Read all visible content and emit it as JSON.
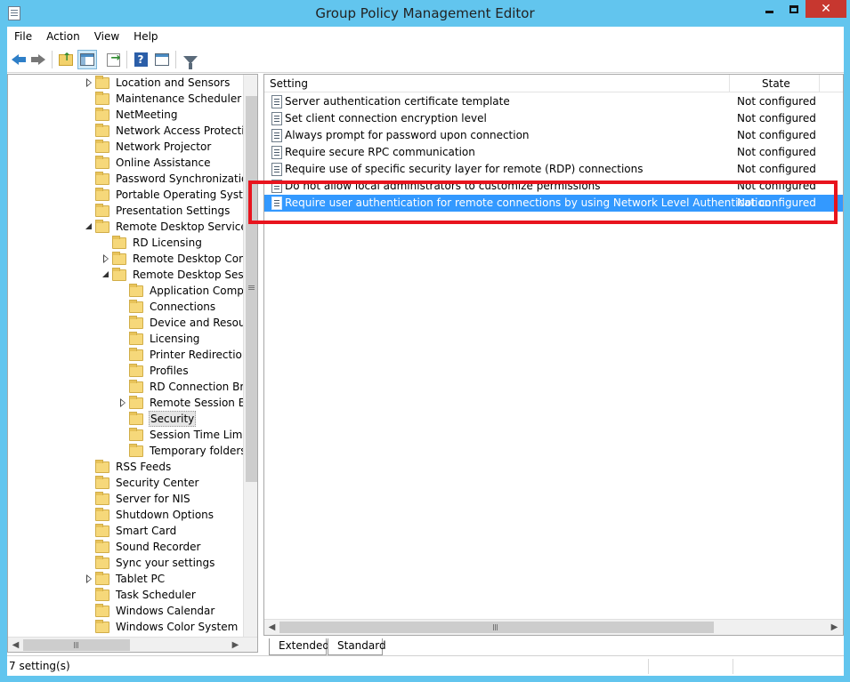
{
  "window": {
    "title": "Group Policy Management Editor",
    "min_symbol": "—",
    "max_symbol": "□",
    "close_symbol": "✕"
  },
  "menu": {
    "items": [
      "File",
      "Action",
      "View",
      "Help"
    ]
  },
  "toolbar": {
    "buttons": [
      "back-icon",
      "forward-icon",
      "up-folder-icon",
      "show-hide-tree-icon",
      "export-list-icon",
      "help-icon",
      "properties-icon",
      "filter-icon"
    ]
  },
  "tree": {
    "items": [
      {
        "label": "Location and Sensors",
        "expander": "collapsed"
      },
      {
        "label": "Maintenance Scheduler",
        "expander": ""
      },
      {
        "label": "NetMeeting",
        "expander": ""
      },
      {
        "label": "Network Access Protection",
        "expander": ""
      },
      {
        "label": "Network Projector",
        "expander": ""
      },
      {
        "label": "Online Assistance",
        "expander": ""
      },
      {
        "label": "Password Synchronization",
        "expander": ""
      },
      {
        "label": "Portable Operating System",
        "expander": ""
      },
      {
        "label": "Presentation Settings",
        "expander": ""
      },
      {
        "label": "Remote Desktop Services",
        "expander": "expanded"
      },
      {
        "label": "RD Licensing",
        "expander": ""
      },
      {
        "label": "Remote Desktop Conne",
        "expander": "collapsed"
      },
      {
        "label": "Remote Desktop Session",
        "expander": "expanded"
      },
      {
        "label": "Application Compat",
        "expander": ""
      },
      {
        "label": "Connections",
        "expander": ""
      },
      {
        "label": "Device and Resource",
        "expander": ""
      },
      {
        "label": "Licensing",
        "expander": ""
      },
      {
        "label": "Printer Redirection",
        "expander": ""
      },
      {
        "label": "Profiles",
        "expander": ""
      },
      {
        "label": "RD Connection Brok",
        "expander": ""
      },
      {
        "label": "Remote Session Envi",
        "expander": "collapsed"
      },
      {
        "label": "Security",
        "expander": "",
        "selected": true
      },
      {
        "label": "Session Time Limits",
        "expander": ""
      },
      {
        "label": "Temporary folders",
        "expander": ""
      },
      {
        "label": "RSS Feeds",
        "expander": ""
      },
      {
        "label": "Security Center",
        "expander": ""
      },
      {
        "label": "Server for NIS",
        "expander": ""
      },
      {
        "label": "Shutdown Options",
        "expander": ""
      },
      {
        "label": "Smart Card",
        "expander": ""
      },
      {
        "label": "Sound Recorder",
        "expander": ""
      },
      {
        "label": "Sync your settings",
        "expander": ""
      },
      {
        "label": "Tablet PC",
        "expander": "collapsed"
      },
      {
        "label": "Task Scheduler",
        "expander": ""
      },
      {
        "label": "Windows Calendar",
        "expander": ""
      },
      {
        "label": "Windows Color System",
        "expander": ""
      }
    ]
  },
  "list": {
    "columns": {
      "setting": "Setting",
      "state": "State"
    },
    "rows": [
      {
        "name": "Server authentication certificate template",
        "state": "Not configured"
      },
      {
        "name": "Set client connection encryption level",
        "state": "Not configured"
      },
      {
        "name": "Always prompt for password upon connection",
        "state": "Not configured"
      },
      {
        "name": "Require secure RPC communication",
        "state": "Not configured"
      },
      {
        "name": "Require use of specific security layer for remote (RDP) connections",
        "state": "Not configured"
      },
      {
        "name": "Do not allow local administrators to customize permissions",
        "state": "Not configured"
      },
      {
        "name": "Require user authentication for remote connections by using Network Level Authentication",
        "state": "Not configured",
        "selected": true
      }
    ]
  },
  "tabs": {
    "extended": "Extended",
    "standard": "Standard"
  },
  "status": {
    "text": "7 setting(s)"
  },
  "colors": {
    "selection": "#3399ff",
    "highlight_box": "#e8141e",
    "window_frame": "#62c5ee",
    "close_button": "#c7372f"
  }
}
